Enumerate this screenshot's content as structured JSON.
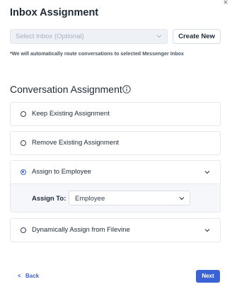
{
  "close": {
    "glyph": "×"
  },
  "inbox": {
    "title": "Inbox Assignment",
    "select_placeholder": "Select Inbox (Optional)",
    "create_button": "Create New",
    "note": "*We will automatically route conversations to selected Messenger Inbox"
  },
  "conversation": {
    "title": "Conversation Assignment",
    "options": [
      {
        "label": "Keep Existing Assignment",
        "selected": false,
        "expandable": false
      },
      {
        "label": "Remove Existing Assignment",
        "selected": false,
        "expandable": false
      },
      {
        "label": "Assign to Employee",
        "selected": true,
        "expandable": true
      },
      {
        "label": "Dynamically Assign from Filevine",
        "selected": false,
        "expandable": true
      }
    ],
    "assign_to_label": "Assign To:",
    "assign_to_value": "Employee"
  },
  "footer": {
    "back_arrow": "<",
    "back_label": "Back",
    "next_label": "Next"
  },
  "colors": {
    "accent": "#3b63d6",
    "text": "#1f2a37",
    "disabled_bg": "#eef1f6"
  },
  "icons": [
    "close-icon",
    "chevron-down-icon",
    "info-icon",
    "radio-icon",
    "back-arrow-icon"
  ]
}
